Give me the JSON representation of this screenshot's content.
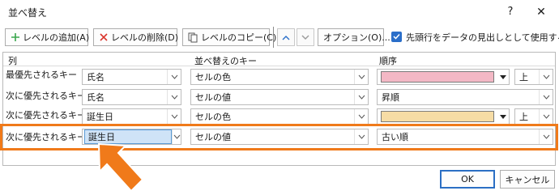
{
  "window": {
    "title": "並べ替え",
    "help": "?",
    "close": "✕"
  },
  "toolbar": {
    "add_level": "レベルの追加(A)",
    "delete_level": "レベルの削除(D)",
    "copy_level": "レベルのコピー(C)",
    "options": "オプション(O)...",
    "header_checkbox_label": "先頭行をデータの見出しとして使用する(H)",
    "header_checkbox_checked": true
  },
  "columns": {
    "col": "列",
    "sort_on": "並べ替えのキー",
    "order": "順序"
  },
  "rows": [
    {
      "label": "最優先されるキー",
      "column": "氏名",
      "sort_on": "セルの色",
      "order_type": "color",
      "color": "#f3b8c5",
      "position": "上"
    },
    {
      "label": "次に優先されるキー",
      "column": "氏名",
      "sort_on": "セルの値",
      "order_type": "text",
      "order": "昇順"
    },
    {
      "label": "次に優先されるキー",
      "column": "誕生日",
      "sort_on": "セルの色",
      "order_type": "color",
      "color": "#f6dca5",
      "position": "上"
    },
    {
      "label": "次に優先されるキー",
      "column": "誕生日",
      "sort_on": "セルの値",
      "order_type": "text",
      "order": "古い順",
      "highlighted": true
    }
  ],
  "footer": {
    "ok": "OK",
    "cancel": "キャンセル"
  },
  "colors": {
    "accent": "#2a6ec9",
    "highlight": "#f07a1a",
    "add_icon": "#3aa64c",
    "delete_icon": "#d9342b"
  }
}
